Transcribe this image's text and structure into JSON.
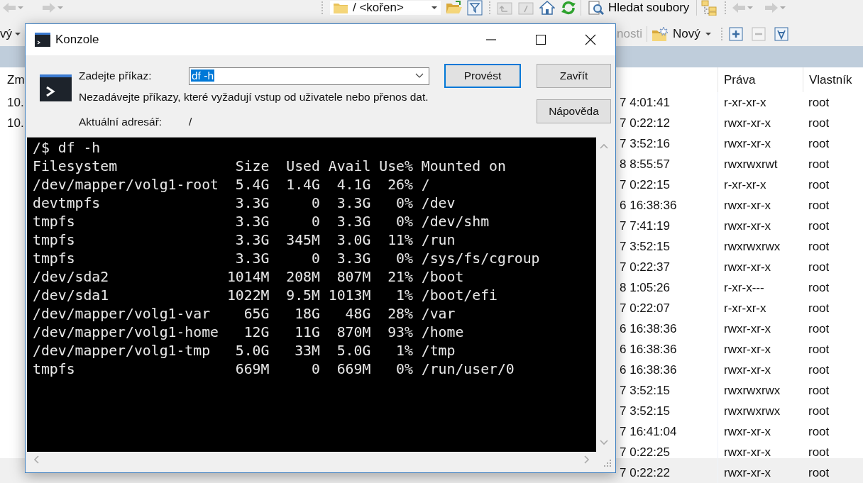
{
  "file_manager": {
    "toolbar_top": {
      "path_dropdown": "/ <kořen>",
      "find_button": "Hledat soubory"
    },
    "toolbar_second": {
      "new_button_left": "vý",
      "properties_button": {
        "label": "nosti",
        "disabled": true
      },
      "new_button": "Nový"
    },
    "left_panel": {
      "columns": [
        "Zm"
      ],
      "rows": [
        "10.",
        "10."
      ]
    },
    "right_panel": {
      "columns": [
        "Práva",
        "Vlastník"
      ],
      "rows": [
        {
          "modified": "7 4:01:41",
          "rights": "r-xr-xr-x",
          "owner": "root"
        },
        {
          "modified": "7 0:22:12",
          "rights": "rwxr-xr-x",
          "owner": "root"
        },
        {
          "modified": "7 3:52:16",
          "rights": "rwxr-xr-x",
          "owner": "root"
        },
        {
          "modified": "8 8:55:57",
          "rights": "rwxrwxrwt",
          "owner": "root"
        },
        {
          "modified": "7 0:22:15",
          "rights": "r-xr-xr-x",
          "owner": "root"
        },
        {
          "modified": "6 16:38:36",
          "rights": "rwxr-xr-x",
          "owner": "root"
        },
        {
          "modified": "7 7:41:19",
          "rights": "rwxr-xr-x",
          "owner": "root"
        },
        {
          "modified": "7 3:52:15",
          "rights": "rwxrwxrwx",
          "owner": "root"
        },
        {
          "modified": "7 0:22:37",
          "rights": "rwxr-xr-x",
          "owner": "root"
        },
        {
          "modified": "8 1:05:26",
          "rights": "r-xr-x---",
          "owner": "root"
        },
        {
          "modified": "7 0:22:07",
          "rights": "r-xr-xr-x",
          "owner": "root"
        },
        {
          "modified": "6 16:38:36",
          "rights": "rwxr-xr-x",
          "owner": "root"
        },
        {
          "modified": "6 16:38:36",
          "rights": "rwxr-xr-x",
          "owner": "root"
        },
        {
          "modified": "6 16:38:36",
          "rights": "rwxr-xr-x",
          "owner": "root"
        },
        {
          "modified": "7 3:52:15",
          "rights": "rwxrwxrwx",
          "owner": "root"
        },
        {
          "modified": "7 3:52:15",
          "rights": "rwxrwxrwx",
          "owner": "root"
        },
        {
          "modified": "7 16:41:04",
          "rights": "rwxr-xr-x",
          "owner": "root"
        },
        {
          "modified": "7 0:22:25",
          "rights": "rwxr-xr-x",
          "owner": "root"
        },
        {
          "modified": "7 0:22:22",
          "rights": "rwxr-xr-x",
          "owner": "root"
        }
      ]
    }
  },
  "dialog": {
    "title": "Konzole",
    "command_label": "Zadejte příkaz:",
    "command_value": "df -h",
    "value_selected": true,
    "warning": "Nezadávejte příkazy, které vyžadují vstup od uživatele nebo přenos dat.",
    "cwd_label": "Aktuální adresář:",
    "cwd": "/",
    "buttons": [
      {
        "label": "Provést",
        "default": true
      },
      {
        "label": "Zavřít",
        "default": false
      },
      {
        "label": "Nápověda",
        "default": false
      }
    ],
    "console": {
      "prompt": "/$ df -h",
      "columns": [
        "Filesystem",
        "Size",
        "Used",
        "Avail",
        "Use%",
        "Mounted on"
      ],
      "rows": [
        [
          "/dev/mapper/volg1-root",
          "5.4G",
          "1.4G",
          "4.1G",
          "26%",
          "/"
        ],
        [
          "devtmpfs",
          "3.3G",
          "0",
          "3.3G",
          "0%",
          "/dev"
        ],
        [
          "tmpfs",
          "3.3G",
          "0",
          "3.3G",
          "0%",
          "/dev/shm"
        ],
        [
          "tmpfs",
          "3.3G",
          "345M",
          "3.0G",
          "11%",
          "/run"
        ],
        [
          "tmpfs",
          "3.3G",
          "0",
          "3.3G",
          "0%",
          "/sys/fs/cgroup"
        ],
        [
          "/dev/sda2",
          "1014M",
          "208M",
          "807M",
          "21%",
          "/boot"
        ],
        [
          "/dev/sda1",
          "1022M",
          "9.5M",
          "1013M",
          "1%",
          "/boot/efi"
        ],
        [
          "/dev/mapper/volg1-var",
          "65G",
          "18G",
          "48G",
          "28%",
          "/var"
        ],
        [
          "/dev/mapper/volg1-home",
          "12G",
          "11G",
          "870M",
          "93%",
          "/home"
        ],
        [
          "/dev/mapper/volg1-tmp",
          "5.0G",
          "33M",
          "5.0G",
          "1%",
          "/tmp"
        ],
        [
          "tmpfs",
          "669M",
          "0",
          "669M",
          "0%",
          "/run/user/0"
        ]
      ]
    }
  }
}
